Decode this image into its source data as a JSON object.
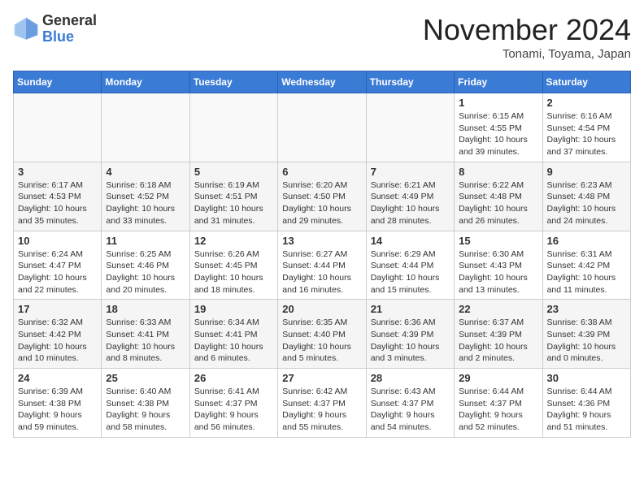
{
  "header": {
    "logo_general": "General",
    "logo_blue": "Blue",
    "month_title": "November 2024",
    "location": "Tonami, Toyama, Japan"
  },
  "days_of_week": [
    "Sunday",
    "Monday",
    "Tuesday",
    "Wednesday",
    "Thursday",
    "Friday",
    "Saturday"
  ],
  "weeks": [
    [
      {
        "day": "",
        "info": ""
      },
      {
        "day": "",
        "info": ""
      },
      {
        "day": "",
        "info": ""
      },
      {
        "day": "",
        "info": ""
      },
      {
        "day": "",
        "info": ""
      },
      {
        "day": "1",
        "info": "Sunrise: 6:15 AM\nSunset: 4:55 PM\nDaylight: 10 hours and 39 minutes."
      },
      {
        "day": "2",
        "info": "Sunrise: 6:16 AM\nSunset: 4:54 PM\nDaylight: 10 hours and 37 minutes."
      }
    ],
    [
      {
        "day": "3",
        "info": "Sunrise: 6:17 AM\nSunset: 4:53 PM\nDaylight: 10 hours and 35 minutes."
      },
      {
        "day": "4",
        "info": "Sunrise: 6:18 AM\nSunset: 4:52 PM\nDaylight: 10 hours and 33 minutes."
      },
      {
        "day": "5",
        "info": "Sunrise: 6:19 AM\nSunset: 4:51 PM\nDaylight: 10 hours and 31 minutes."
      },
      {
        "day": "6",
        "info": "Sunrise: 6:20 AM\nSunset: 4:50 PM\nDaylight: 10 hours and 29 minutes."
      },
      {
        "day": "7",
        "info": "Sunrise: 6:21 AM\nSunset: 4:49 PM\nDaylight: 10 hours and 28 minutes."
      },
      {
        "day": "8",
        "info": "Sunrise: 6:22 AM\nSunset: 4:48 PM\nDaylight: 10 hours and 26 minutes."
      },
      {
        "day": "9",
        "info": "Sunrise: 6:23 AM\nSunset: 4:48 PM\nDaylight: 10 hours and 24 minutes."
      }
    ],
    [
      {
        "day": "10",
        "info": "Sunrise: 6:24 AM\nSunset: 4:47 PM\nDaylight: 10 hours and 22 minutes."
      },
      {
        "day": "11",
        "info": "Sunrise: 6:25 AM\nSunset: 4:46 PM\nDaylight: 10 hours and 20 minutes."
      },
      {
        "day": "12",
        "info": "Sunrise: 6:26 AM\nSunset: 4:45 PM\nDaylight: 10 hours and 18 minutes."
      },
      {
        "day": "13",
        "info": "Sunrise: 6:27 AM\nSunset: 4:44 PM\nDaylight: 10 hours and 16 minutes."
      },
      {
        "day": "14",
        "info": "Sunrise: 6:29 AM\nSunset: 4:44 PM\nDaylight: 10 hours and 15 minutes."
      },
      {
        "day": "15",
        "info": "Sunrise: 6:30 AM\nSunset: 4:43 PM\nDaylight: 10 hours and 13 minutes."
      },
      {
        "day": "16",
        "info": "Sunrise: 6:31 AM\nSunset: 4:42 PM\nDaylight: 10 hours and 11 minutes."
      }
    ],
    [
      {
        "day": "17",
        "info": "Sunrise: 6:32 AM\nSunset: 4:42 PM\nDaylight: 10 hours and 10 minutes."
      },
      {
        "day": "18",
        "info": "Sunrise: 6:33 AM\nSunset: 4:41 PM\nDaylight: 10 hours and 8 minutes."
      },
      {
        "day": "19",
        "info": "Sunrise: 6:34 AM\nSunset: 4:41 PM\nDaylight: 10 hours and 6 minutes."
      },
      {
        "day": "20",
        "info": "Sunrise: 6:35 AM\nSunset: 4:40 PM\nDaylight: 10 hours and 5 minutes."
      },
      {
        "day": "21",
        "info": "Sunrise: 6:36 AM\nSunset: 4:39 PM\nDaylight: 10 hours and 3 minutes."
      },
      {
        "day": "22",
        "info": "Sunrise: 6:37 AM\nSunset: 4:39 PM\nDaylight: 10 hours and 2 minutes."
      },
      {
        "day": "23",
        "info": "Sunrise: 6:38 AM\nSunset: 4:39 PM\nDaylight: 10 hours and 0 minutes."
      }
    ],
    [
      {
        "day": "24",
        "info": "Sunrise: 6:39 AM\nSunset: 4:38 PM\nDaylight: 9 hours and 59 minutes."
      },
      {
        "day": "25",
        "info": "Sunrise: 6:40 AM\nSunset: 4:38 PM\nDaylight: 9 hours and 58 minutes."
      },
      {
        "day": "26",
        "info": "Sunrise: 6:41 AM\nSunset: 4:37 PM\nDaylight: 9 hours and 56 minutes."
      },
      {
        "day": "27",
        "info": "Sunrise: 6:42 AM\nSunset: 4:37 PM\nDaylight: 9 hours and 55 minutes."
      },
      {
        "day": "28",
        "info": "Sunrise: 6:43 AM\nSunset: 4:37 PM\nDaylight: 9 hours and 54 minutes."
      },
      {
        "day": "29",
        "info": "Sunrise: 6:44 AM\nSunset: 4:37 PM\nDaylight: 9 hours and 52 minutes."
      },
      {
        "day": "30",
        "info": "Sunrise: 6:44 AM\nSunset: 4:36 PM\nDaylight: 9 hours and 51 minutes."
      }
    ]
  ]
}
